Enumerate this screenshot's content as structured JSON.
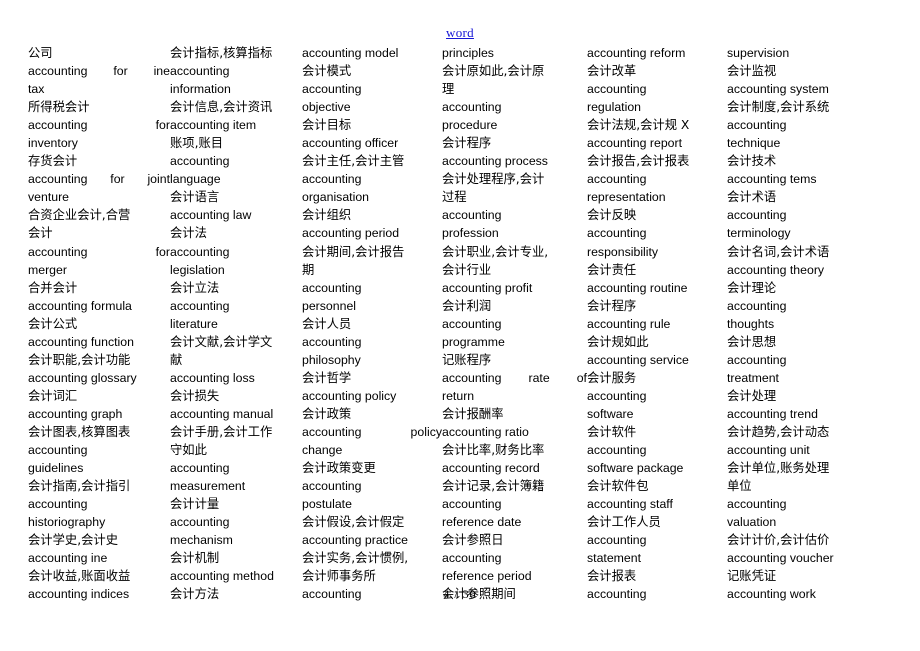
{
  "header": {
    "link_label": "word"
  },
  "footer": {
    "page_indicator": "4 / 30",
    "current_page": "4",
    "total_pages": "30"
  },
  "colors": {
    "link": "#1414d6",
    "text": "#000000",
    "background": "#ffffff"
  },
  "columns": [
    {
      "index": 0,
      "lines": [
        "公司",
        "accounting for ine",
        "tax",
        "所得税会计",
        "accounting for",
        "inventory",
        "存货会计",
        "accounting for joint",
        "venture",
        "合资企业会计,合营",
        "会计",
        "accounting for",
        "merger",
        "合并会计",
        "accounting formula",
        "会计公式",
        "accounting function",
        "会计职能,会计功能",
        "accounting glossary",
        "会计词汇",
        "accounting graph",
        "会计图表,核算图表",
        "accounting",
        "guidelines",
        "会计指南,会计指引",
        "accounting",
        "historiography",
        "会计学史,会计史",
        "accounting ine",
        "会计收益,账面收益",
        "accounting indices"
      ],
      "justified": [
        1,
        4,
        7,
        11
      ]
    },
    {
      "index": 1,
      "lines": [
        "会计指标,核算指标",
        "accounting",
        "information",
        "会计信息,会计资讯",
        "accounting item",
        "账项,账目",
        "accounting",
        "language",
        "会计语言",
        "accounting law",
        "会计法",
        "accounting",
        "legislation",
        "会计立法",
        "accounting",
        "literature",
        "会计文献,会计学文",
        "献",
        "accounting loss",
        "会计损失",
        "accounting manual",
        "会计手册,会计工作",
        "守如此",
        "accounting",
        "measurement",
        "会计计量",
        "accounting",
        "mechanism",
        "会计机制",
        "accounting method",
        "会计方法"
      ],
      "justified": []
    },
    {
      "index": 2,
      "lines": [
        "accounting model",
        "会计模式",
        "accounting",
        "objective",
        "会计目标",
        "accounting officer",
        "会计主任,会计主管",
        "accounting",
        "organisation",
        "会计组织",
        "accounting period",
        "会计期间,会计报告",
        "期",
        "accounting",
        "personnel",
        "会计人员",
        "accounting",
        "philosophy",
        "会计哲学",
        "accounting policy",
        "会计政策",
        "accounting policy",
        "change",
        "会计政策变更",
        "accounting",
        "postulate",
        "会计假设,会计假定",
        "accounting practice",
        "会计实务,会计惯例,",
        "会计师事务所",
        "accounting"
      ],
      "justified": [
        21
      ]
    },
    {
      "index": 3,
      "lines": [
        "principles",
        "会计原如此,会计原",
        "理",
        "accounting",
        "procedure",
        "会计程序",
        "accounting process",
        "会计处理程序,会计",
        "过程",
        "accounting",
        "profession",
        "会计职业,会计专业,",
        "会计行业",
        "accounting profit",
        "会计利润",
        "accounting",
        "programme",
        "记账程序",
        "accounting rate of",
        "return",
        "会计报酬率",
        "accounting ratio",
        "会计比率,财务比率",
        "accounting record",
        "会计记录,会计簿籍",
        "accounting",
        "reference date",
        "会计参照日",
        "accounting",
        "reference period",
        "会计参照期间"
      ],
      "justified": [
        18
      ]
    },
    {
      "index": 4,
      "lines": [
        "accounting reform",
        "会计改革",
        "accounting",
        "regulation",
        "会计法规,会计规 X",
        "accounting report",
        "会计报告,会计报表",
        "accounting",
        "representation",
        "会计反映",
        "accounting",
        "responsibility",
        "会计责任",
        "accounting routine",
        "会计程序",
        "accounting rule",
        "会计规如此",
        "accounting service",
        "会计服务",
        "accounting",
        "software",
        "会计软件",
        "accounting",
        "software package",
        "会计软件包",
        "accounting staff",
        "会计工作人员",
        "accounting",
        "statement",
        "会计报表",
        "accounting"
      ],
      "justified": []
    },
    {
      "index": 5,
      "lines": [
        "supervision",
        "会计监视",
        "accounting system",
        "会计制度,会计系统",
        "accounting",
        "technique",
        "会计技术",
        "accounting tems",
        "会计术语",
        "accounting",
        "terminology",
        "会计名词,会计术语",
        "accounting theory",
        "会计理论",
        "accounting",
        "thoughts",
        "会计思想",
        "accounting",
        "treatment",
        "会计处理",
        "accounting trend",
        "会计趋势,会计动态",
        "accounting unit",
        "会计单位,账务处理",
        "单位",
        "accounting",
        "valuation",
        "会计计价,会计估价",
        "accounting voucher",
        "记账凭证",
        "accounting work"
      ],
      "justified": []
    }
  ]
}
